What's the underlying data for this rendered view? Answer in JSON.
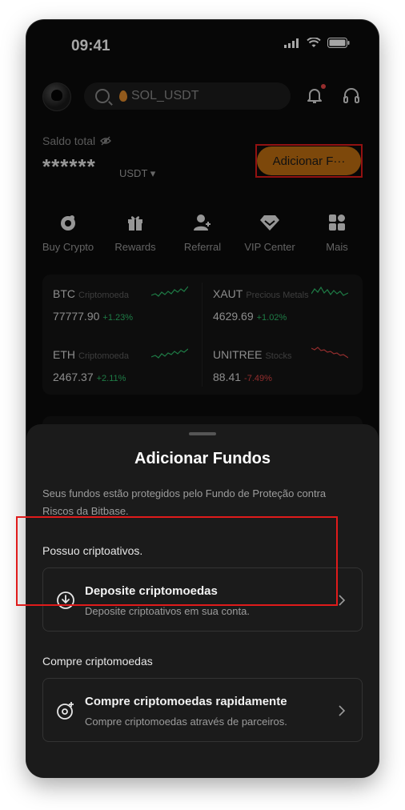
{
  "status": {
    "time": "09:41"
  },
  "header": {
    "search_placeholder": "SOL_USDT"
  },
  "balance": {
    "label": "Saldo total",
    "value": "******",
    "currency": "USDT ▾",
    "add_button": "Adicionar F···"
  },
  "quick_actions": [
    {
      "label": "Buy Crypto",
      "icon": "buy-crypto-icon"
    },
    {
      "label": "Rewards",
      "icon": "gift-icon"
    },
    {
      "label": "Referral",
      "icon": "referral-icon"
    },
    {
      "label": "VIP Center",
      "icon": "diamond-icon"
    },
    {
      "label": "Mais",
      "icon": "grid-icon"
    }
  ],
  "markets": [
    {
      "symbol": "BTC",
      "type": "Criptomoeda",
      "price": "77777.90",
      "change": "+1.23%",
      "color": "#2ebd6b"
    },
    {
      "symbol": "XAUT",
      "type": "Precious Metals",
      "price": "4629.69",
      "change": "+1.02%",
      "color": "#2ebd6b"
    },
    {
      "symbol": "ETH",
      "type": "Criptomoeda",
      "price": "2467.37",
      "change": "+2.11%",
      "color": "#2ebd6b"
    },
    {
      "symbol": "UNITREE",
      "type": "Stocks",
      "price": "88.41",
      "change": "-7.49%",
      "color": "#e04545"
    }
  ],
  "sheet": {
    "title": "Adicionar Fundos",
    "description": "Seus fundos estão protegidos pelo Fundo de Proteção contra Riscos da Bitbase.",
    "section1": "Possuo criptoativos.",
    "deposit_title": "Deposite criptomoedas",
    "deposit_sub": "Deposite criptoativos em sua conta.",
    "section2": "Compre criptomoedas",
    "buy_title": "Compre criptomoedas rapidamente",
    "buy_sub": "Compre criptomoedas através de parceiros."
  }
}
